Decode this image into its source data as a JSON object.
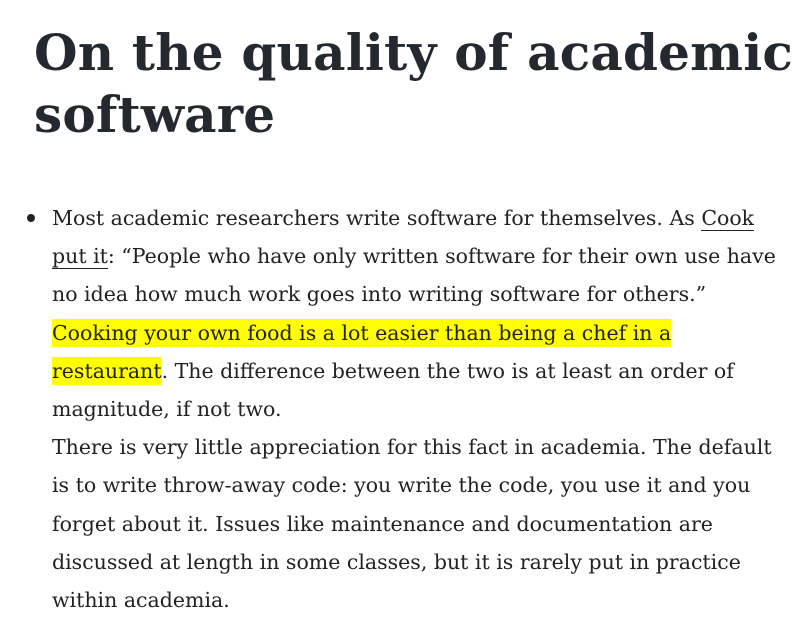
{
  "article": {
    "title": "On the quality of academic software"
  },
  "item": {
    "p1_before_link": "Most academic researchers write software for themselves. As ",
    "link_text": "Cook put it",
    "p1_after_link": ": “People who have only written software for their own use have no idea how much work goes into writing software for others.” ",
    "highlight": "Cooking your own food is a lot easier than being a chef in a restaurant",
    "p1_end": ". The difference between the two is at least an order of magnitude, if not two.",
    "p2": "There is very little appreciation for this fact in academia. The de­fault is to write throw-away code: you write the code, you use it and you forget about it. Issues like maintenance and documenta­tion are discussed at length in some classes, but it is rarely put in practice within academia.",
    "highlight_color": "#ffff00"
  }
}
